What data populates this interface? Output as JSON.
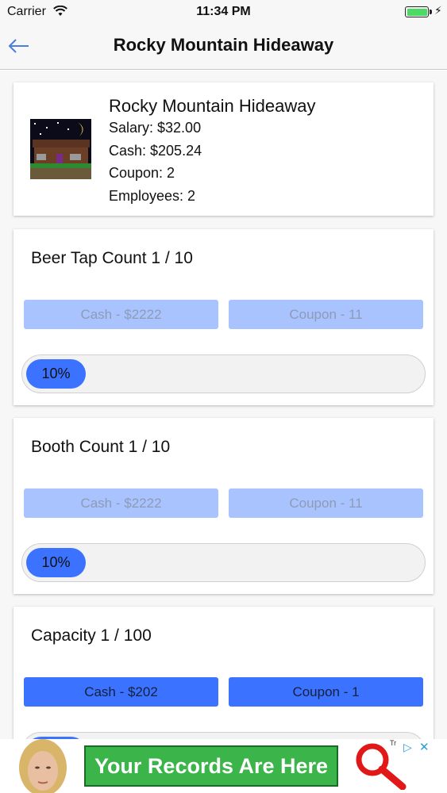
{
  "status_bar": {
    "carrier": "Carrier",
    "time": "11:34 PM"
  },
  "nav": {
    "title": "Rocky Mountain Hideaway",
    "back_icon": "back-arrow-icon"
  },
  "business": {
    "name": "Rocky Mountain Hideaway",
    "salary": "Salary: $32.00",
    "cash": "Cash: $205.24",
    "coupon": "Coupon: 2",
    "employees": "Employees: 2"
  },
  "upgrades": [
    {
      "title": "Beer Tap Count 1 / 10",
      "cash_label": "Cash - $2222",
      "coupon_label": "Coupon - 11",
      "enabled": false,
      "progress_label": "10%",
      "progress": 0.1
    },
    {
      "title": "Booth Count 1 / 10",
      "cash_label": "Cash - $2222",
      "coupon_label": "Coupon - 11",
      "enabled": false,
      "progress_label": "10%",
      "progress": 0.1
    },
    {
      "title": "Capacity 1 / 100",
      "cash_label": "Cash - $202",
      "coupon_label": "Coupon - 1",
      "enabled": true,
      "progress_label": "",
      "progress": 0.01
    }
  ],
  "ad": {
    "headline": "Your Records Are Here",
    "tr": "Tr",
    "close": "✕"
  },
  "colors": {
    "accent": "#3b72ff",
    "disabled_button": "#a9c3ff",
    "ad_green": "#3bb54a"
  }
}
